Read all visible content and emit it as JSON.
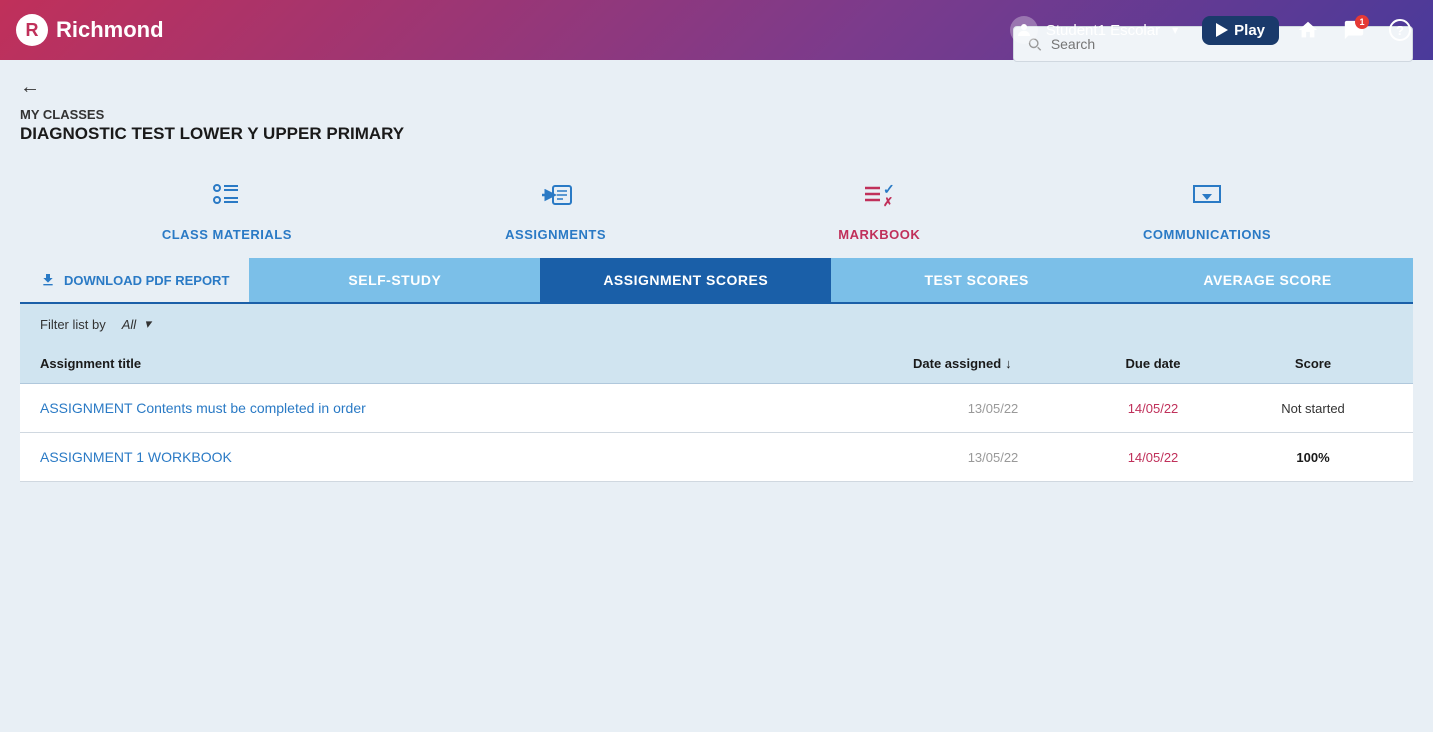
{
  "header": {
    "logo_text": "Richmond",
    "user_name": "Student1 Escolar",
    "play_label": "Play",
    "home_icon": "home-icon",
    "message_icon": "message-icon",
    "help_icon": "help-icon",
    "notification_count": "1"
  },
  "breadcrumb": {
    "my_classes": "MY CLASSES",
    "class_name": "DIAGNOSTIC TEST LOWER Y UPPER PRIMARY"
  },
  "search": {
    "placeholder": "Search"
  },
  "nav": {
    "items": [
      {
        "id": "class-materials",
        "label": "CLASS MATERIALS",
        "color": "blue"
      },
      {
        "id": "assignments",
        "label": "ASSIGNMENTS",
        "color": "blue"
      },
      {
        "id": "markbook",
        "label": "MARKBOOK",
        "color": "red"
      },
      {
        "id": "communications",
        "label": "COMMUNICATIONS",
        "color": "blue"
      }
    ]
  },
  "tabs": {
    "download_label": "DOWNLOAD PDF REPORT",
    "items": [
      {
        "id": "self-study",
        "label": "SELF-STUDY",
        "active": false
      },
      {
        "id": "assignment-scores",
        "label": "ASSIGNMENT SCORES",
        "active": true
      },
      {
        "id": "test-scores",
        "label": "TEST SCORES",
        "active": false
      },
      {
        "id": "average-score",
        "label": "AVERAGE SCORE",
        "active": false
      }
    ]
  },
  "filter": {
    "label": "Filter list by",
    "value": "All"
  },
  "table": {
    "columns": {
      "title": "Assignment title",
      "date_assigned": "Date assigned",
      "due_date": "Due date",
      "score": "Score"
    },
    "rows": [
      {
        "title": "ASSIGNMENT Contents must be completed in order",
        "date_assigned": "13/05/22",
        "due_date": "14/05/22",
        "score": "Not started",
        "score_bold": false
      },
      {
        "title": "ASSIGNMENT 1 WORKBOOK",
        "date_assigned": "13/05/22",
        "due_date": "14/05/22",
        "score": "100%",
        "score_bold": true
      }
    ]
  }
}
